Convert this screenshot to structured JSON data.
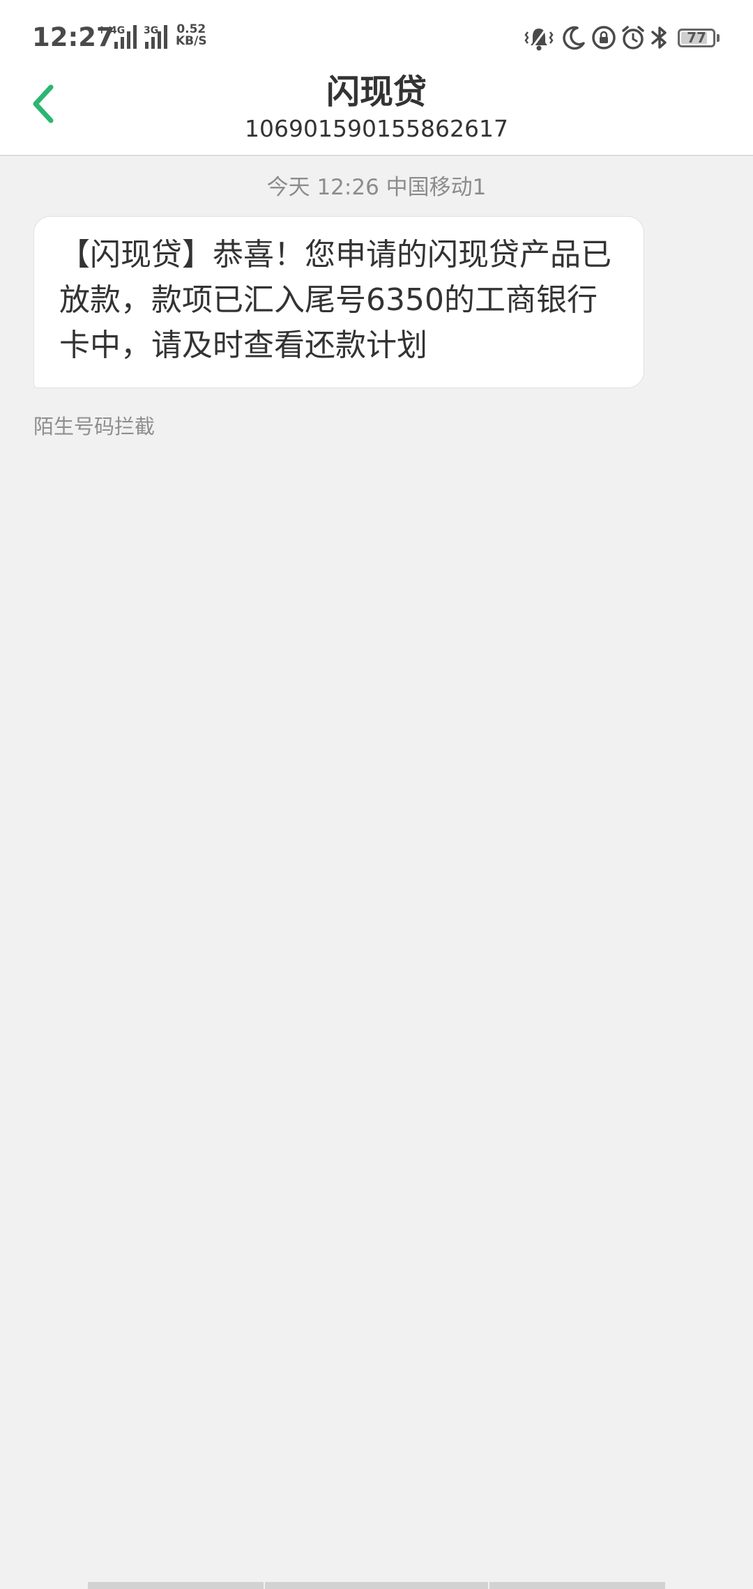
{
  "status_bar": {
    "time": "12:27",
    "network_1": "4G",
    "network_1_prefix": "↑↓",
    "network_2": "3G",
    "speed_value": "0.52",
    "speed_unit": "KB/S",
    "battery_level": "77",
    "icons": [
      "vibrate-icon",
      "moon-icon",
      "rotation-lock-icon",
      "alarm-icon",
      "bluetooth-icon",
      "battery-icon"
    ]
  },
  "header": {
    "title": "闪现贷",
    "number": "106901590155862617",
    "back_icon": "chevron-left-icon",
    "accent_color": "#2bb673"
  },
  "conversation": {
    "timestamp": "今天 12:26  中国移动1",
    "message": "【闪现贷】恭喜！您申请的闪现贷产品已放款，款项已汇入尾号6350的工商银行卡中，请及时查看还款计划",
    "note": "陌生号码拦截"
  }
}
